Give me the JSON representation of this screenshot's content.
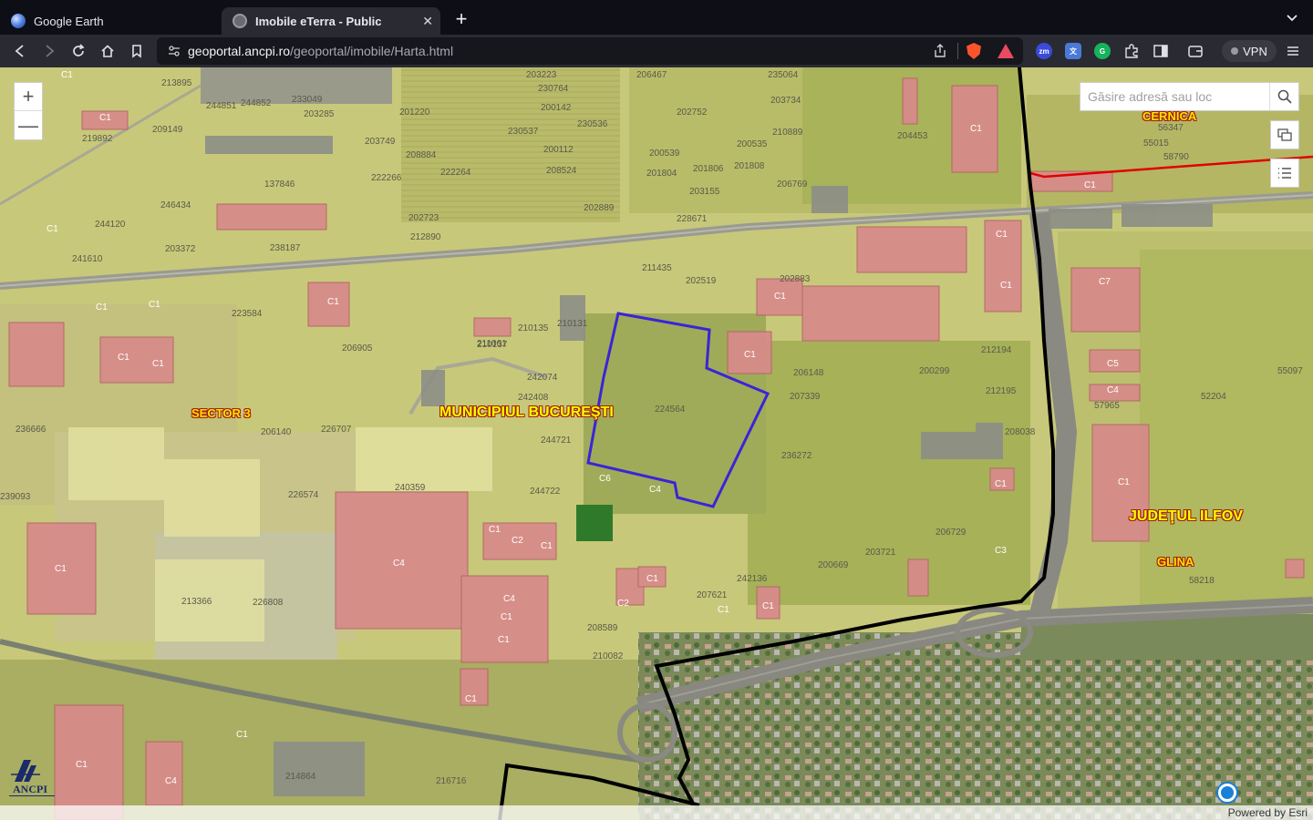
{
  "tabs": [
    {
      "title": "Google Earth",
      "favicon": "google-earth-icon",
      "active": false
    },
    {
      "title": "Imobile eTerra - Public",
      "favicon": "globe-icon",
      "active": true
    }
  ],
  "toolbar": {
    "url_host": "geoportal.ancpi.ro",
    "url_path": "/geoportal/imobile/Harta.html",
    "vpn_label": "VPN",
    "extensions": [
      "zm",
      "translate",
      "grammarly",
      "puzzle"
    ]
  },
  "map": {
    "search_placeholder": "Găsire adresă sau loc",
    "regions": {
      "municipiu": "MUNICIPIUL BUCUREŞTI",
      "sector": "SECTOR 3",
      "judet": "JUDEŢUL ILFOV",
      "cernica": "CERNICA",
      "glina": "GLINA"
    },
    "parcels": [
      "213895",
      "244851",
      "244852",
      "233049",
      "203285",
      "201220",
      "203223",
      "230764",
      "206467",
      "235064",
      "209149",
      "200142",
      "230536",
      "202752",
      "203734",
      "219892",
      "230537",
      "210889",
      "203749",
      "200112",
      "200539",
      "200535",
      "204453",
      "208884",
      "222264",
      "208524",
      "201806",
      "201808",
      "137846",
      "222266",
      "201804",
      "206769",
      "246434",
      "203155",
      "202723",
      "202889",
      "228671",
      "244120",
      "212890",
      "238187",
      "203372",
      "241610",
      "211435",
      "202519",
      "202883",
      "223584",
      "210135",
      "210131",
      "210137",
      "206905",
      "212194",
      "242074",
      "206148",
      "242408",
      "207339",
      "200299",
      "212195",
      "236666",
      "226707",
      "224564",
      "244721",
      "208038",
      "236272",
      "226574",
      "240359",
      "244722",
      "239093",
      "206729",
      "200669",
      "203721",
      "213366",
      "226808",
      "242136",
      "207621",
      "214864",
      "56347",
      "55015",
      "58790",
      "57965",
      "55097",
      "52204",
      "58218",
      "216716",
      "211061",
      "210082",
      "208589",
      "206140"
    ],
    "building_tags": [
      "C1",
      "C2",
      "C3",
      "C4",
      "C5",
      "C6",
      "C7"
    ],
    "logo_text": "ANCPI",
    "attribution": "Powered by Esri"
  }
}
